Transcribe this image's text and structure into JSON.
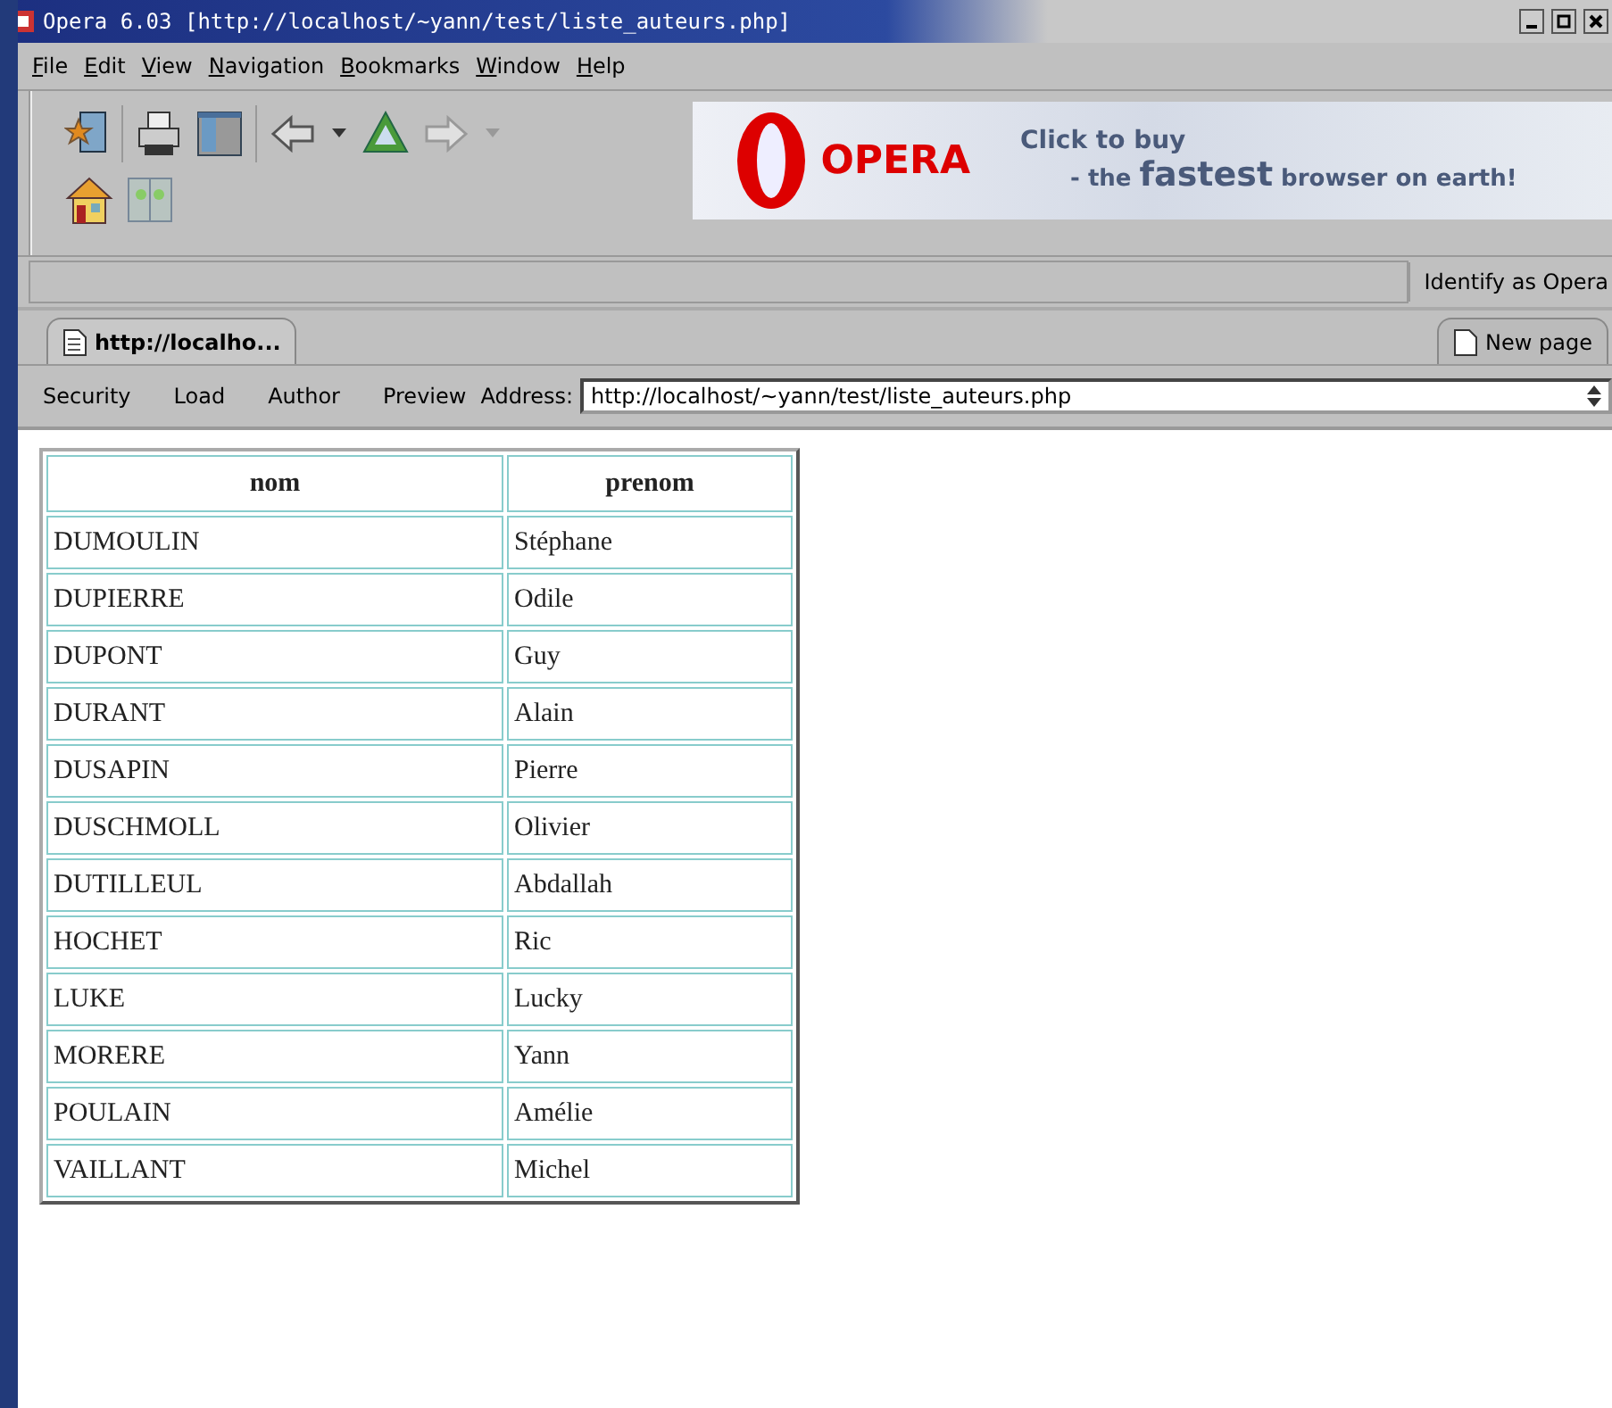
{
  "window": {
    "title": "Opera 6.03  [http://localhost/~yann/test/liste_auteurs.php]"
  },
  "menu": [
    "File",
    "Edit",
    "View",
    "Navigation",
    "Bookmarks",
    "Window",
    "Help"
  ],
  "banner": {
    "brand": "OPERA",
    "line_1": "Click to buy",
    "line_2": "- the **fastest** browser on earth!"
  },
  "status": {
    "identify": "Identify as Opera"
  },
  "tabs": [
    {
      "label": "http://localho...",
      "selected": true
    }
  ],
  "new_page": "New page",
  "address_bar": {
    "buttons": [
      "Security",
      "Load",
      "Author",
      "Preview"
    ],
    "label": "Address:",
    "url": "http://localhost/~yann/test/liste_auteurs.php"
  },
  "table": {
    "columns": [
      "nom",
      "prenom"
    ],
    "rows": [
      [
        "DUMOULIN",
        "Stéphane"
      ],
      [
        "DUPIERRE",
        "Odile"
      ],
      [
        "DUPONT",
        "Guy"
      ],
      [
        "DURANT",
        "Alain"
      ],
      [
        "DUSAPIN",
        "Pierre"
      ],
      [
        "DUSCHMOLL",
        "Olivier"
      ],
      [
        "DUTILLEUL",
        "Abdallah"
      ],
      [
        "HOCHET",
        "Ric"
      ],
      [
        "LUKE",
        "Lucky"
      ],
      [
        "MORERE",
        "Yann"
      ],
      [
        "POULAIN",
        "Amélie"
      ],
      [
        "VAILLANT",
        "Michel"
      ]
    ]
  }
}
